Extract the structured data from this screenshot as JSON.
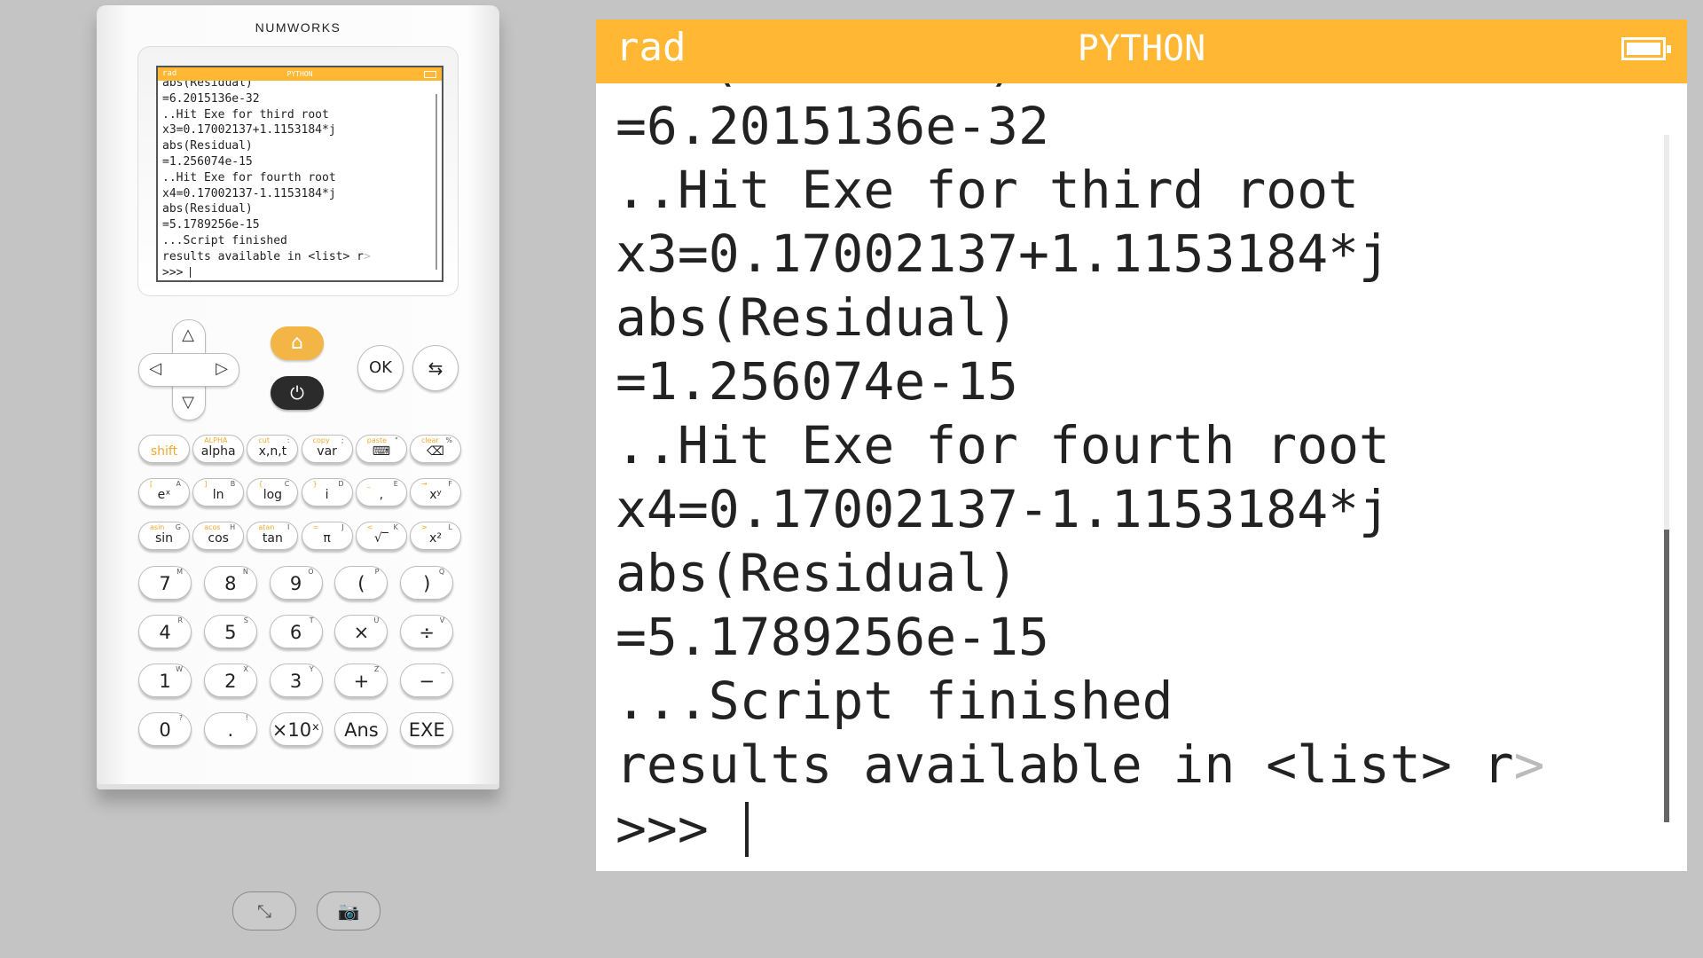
{
  "calculator": {
    "brand": "NUMWORKS",
    "nav": {
      "up": "△",
      "down": "▽",
      "left": "◁",
      "right": "▷",
      "ok": "OK",
      "back": "⇆"
    },
    "rows": [
      [
        {
          "main": "shift",
          "sec": "",
          "ter": ""
        },
        {
          "main": "alpha",
          "sec": "ALPHA",
          "ter": ""
        },
        {
          "main": "x,n,t",
          "sec": "cut",
          "ter": ":"
        },
        {
          "main": "var",
          "sec": "copy",
          "ter": ";"
        },
        {
          "main": "⌨",
          "sec": "paste",
          "ter": "\""
        },
        {
          "main": "⌫",
          "sec": "clear",
          "ter": "%"
        }
      ],
      [
        {
          "main": "eˣ",
          "sec": "[",
          "ter": "A"
        },
        {
          "main": "ln",
          "sec": "]",
          "ter": "B"
        },
        {
          "main": "log",
          "sec": "{",
          "ter": "C"
        },
        {
          "main": "i",
          "sec": "}",
          "ter": "D"
        },
        {
          "main": ",",
          "sec": "_",
          "ter": "E"
        },
        {
          "main": "xʸ",
          "sec": "→",
          "ter": "F"
        }
      ],
      [
        {
          "main": "sin",
          "sec": "asin",
          "ter": "G"
        },
        {
          "main": "cos",
          "sec": "acos",
          "ter": "H"
        },
        {
          "main": "tan",
          "sec": "atan",
          "ter": "I"
        },
        {
          "main": "π",
          "sec": "=",
          "ter": "J"
        },
        {
          "main": "√‾",
          "sec": "<",
          "ter": "K"
        },
        {
          "main": "x²",
          "sec": ">",
          "ter": "L"
        }
      ],
      [
        {
          "main": "7",
          "ter": "M"
        },
        {
          "main": "8",
          "ter": "N"
        },
        {
          "main": "9",
          "ter": "O"
        },
        {
          "main": "(",
          "ter": "P"
        },
        {
          "main": ")",
          "ter": "Q"
        }
      ],
      [
        {
          "main": "4",
          "ter": "R"
        },
        {
          "main": "5",
          "ter": "S"
        },
        {
          "main": "6",
          "ter": "T"
        },
        {
          "main": "×",
          "ter": "U"
        },
        {
          "main": "÷",
          "ter": "V"
        }
      ],
      [
        {
          "main": "1",
          "ter": "W"
        },
        {
          "main": "2",
          "ter": "X"
        },
        {
          "main": "3",
          "ter": "Y"
        },
        {
          "main": "+",
          "ter": "Z"
        },
        {
          "main": "−",
          "ter": "_"
        }
      ],
      [
        {
          "main": "0",
          "ter": "?"
        },
        {
          "main": ".",
          "ter": "!"
        },
        {
          "main": "×10ˣ",
          "ter": ""
        },
        {
          "main": "Ans",
          "ter": ""
        },
        {
          "main": "EXE",
          "ter": ""
        }
      ]
    ]
  },
  "screen": {
    "angle_mode": "rad",
    "app_name": "PYTHON",
    "partial_top_line": "abs(Residual)",
    "lines": [
      "=6.2015136e-32",
      "..Hit Exe for third root",
      "x3=0.17002137+1.1153184*j",
      "abs(Residual)",
      "=1.256074e-15",
      "..Hit Exe for fourth root",
      "x4=0.17002137-1.1153184*j",
      "abs(Residual)",
      "=5.1789256e-15",
      "...Script finished",
      "results available in <list> r"
    ],
    "truncation_marker": ">",
    "prompt": ">>> "
  },
  "toolbar": {
    "fullscreen_icon": "fullscreen-icon",
    "screenshot_icon": "camera-icon"
  }
}
